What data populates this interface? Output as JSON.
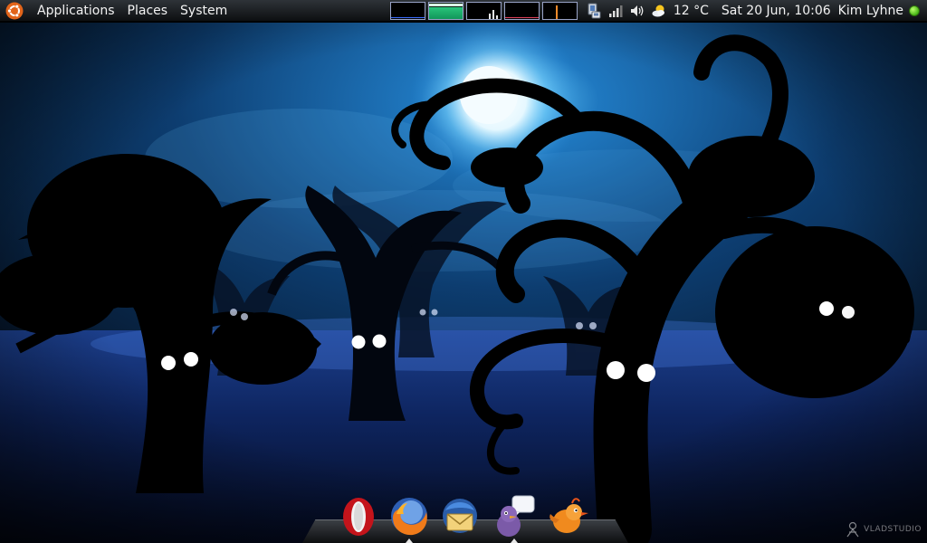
{
  "top_panel": {
    "menus": [
      "Applications",
      "Places",
      "System"
    ],
    "weather": {
      "icon": "partly-cloudy-icon",
      "temperature": "12 °C"
    },
    "clock": "Sat 20 Jun, 10:06",
    "user": "Kim Lyhne",
    "status_color": "#4fc21b",
    "monitors": [
      "cpu",
      "memory",
      "network",
      "swap",
      "load"
    ],
    "tray_icons": [
      "network-manager-icon",
      "signal-strength-icon",
      "volume-icon"
    ]
  },
  "dock": {
    "items": [
      {
        "name": "opera",
        "icon": "opera-icon",
        "running": false
      },
      {
        "name": "firefox",
        "icon": "firefox-icon",
        "running": true
      },
      {
        "name": "thunderbird",
        "icon": "thunderbird-icon",
        "running": false
      },
      {
        "name": "pidgin",
        "icon": "pidgin-icon",
        "running": true
      },
      {
        "name": "gwibber",
        "icon": "bird-icon",
        "running": false
      }
    ]
  },
  "wallpaper": {
    "watermark": "VLADSTUDIO"
  }
}
